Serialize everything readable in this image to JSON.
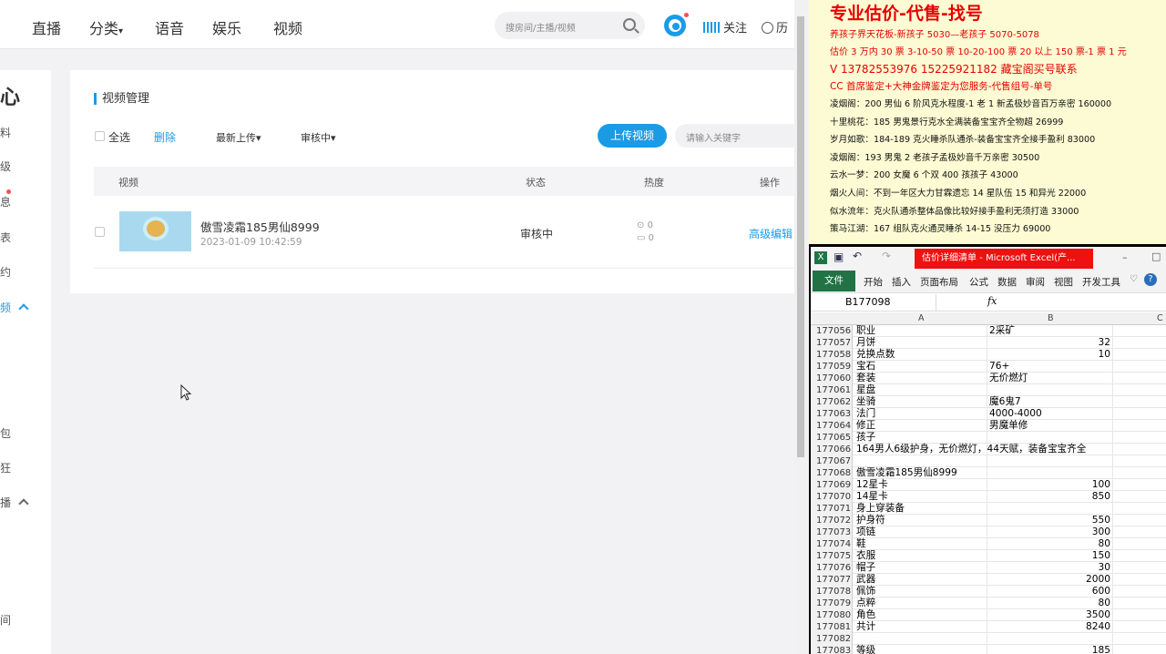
{
  "topnav": {
    "items": [
      "直播",
      "分类",
      "语音",
      "娱乐",
      "视频"
    ],
    "search_placeholder": "搜房间/主播/视频",
    "follow_label": "关注",
    "history_label": "历"
  },
  "sidebar": {
    "chars": [
      "心",
      "料",
      "级",
      "息",
      "表",
      "约",
      "频",
      "包",
      "狂",
      "播",
      "间"
    ]
  },
  "video_manage": {
    "title": "视频管理",
    "select_all": "全选",
    "delete": "删除",
    "sort": "最新上传",
    "filter": "审核中",
    "upload": "上传视频",
    "keyword_placeholder": "请输入关键字",
    "columns": [
      "视频",
      "状态",
      "热度",
      "操作"
    ],
    "row": {
      "title": "傲雪凌霜185男仙8999",
      "date": "2023-01-09 10:42:59",
      "status": "审核中",
      "plays": "0",
      "comments": "0",
      "action": "高级编辑"
    }
  },
  "notes": {
    "heading": "专业估价-代售-找号",
    "lines_red_small": [
      "养孩子界天花板-新孩子 5030—老孩子 5070-5078",
      "估价 3 万内 30 票  3-10-50 票  10-20-100 票 20 以上 150 票-1 票 1 元"
    ],
    "contact": "V 13782553976    15225921182   藏宝阁买号联系",
    "cc_line": "CC 首席鉴定+大神金牌鉴定为您服务-代售组号-单号",
    "lines": [
      "凌烟阁：200 男仙 6 阶风克水程度-1 老 1 新孟极妙音百万亲密 160000",
      "十里桃花：185 男鬼景行克水全满装备宝宝齐全物超 26999",
      "岁月如歌：184-189 克火睡杀队通杀-装备宝宝齐全接手盈利 83000",
      "凌烟阁：193 男鬼 2 老孩子孟极妙音千万亲密 30500",
      "云水一梦：200 女魔 6 个双 400 孩孩子 43000",
      "烟火人间：不到一年区大力甘霖遗忘 14 星队伍 15 和异光 22000",
      "似水流年：克火队通杀整体品像比较好接手盈利无须打造 33000",
      "策马江湖：167 组队克火通灵睡杀 14-15 没压力 69000"
    ]
  },
  "excel": {
    "title": "估价详细清单 - Microsoft Excel(产...",
    "tabs": [
      "文件",
      "开始",
      "插入",
      "页面布局",
      "公式",
      "数据",
      "审阅",
      "视图",
      "开发工具"
    ],
    "namebox": "B177098",
    "fx": "fx",
    "col_headers": [
      "A",
      "B",
      "C"
    ],
    "rows": [
      {
        "n": "177056",
        "a": "职业",
        "b": "2采矿",
        "num": false
      },
      {
        "n": "177057",
        "a": "月饼",
        "b": "32",
        "num": true
      },
      {
        "n": "177058",
        "a": "兑换点数",
        "b": "10",
        "num": true
      },
      {
        "n": "177059",
        "a": "宝石",
        "b": "76+",
        "num": false
      },
      {
        "n": "177060",
        "a": "套装",
        "b": "无价燃灯",
        "num": false
      },
      {
        "n": "177061",
        "a": "星盘",
        "b": "",
        "num": false
      },
      {
        "n": "177062",
        "a": "坐骑",
        "b": "魔6鬼7",
        "num": false
      },
      {
        "n": "177063",
        "a": "法门",
        "b": "4000-4000",
        "num": false
      },
      {
        "n": "177064",
        "a": "修正",
        "b": "男魔单修",
        "num": false
      },
      {
        "n": "177065",
        "a": "孩子",
        "b": "",
        "num": false
      },
      {
        "n": "177066",
        "a": "164男人6级护身，无价燃灯，44天赋，装备宝宝齐全",
        "b": "",
        "num": false
      },
      {
        "n": "177067",
        "a": "",
        "b": "",
        "num": false
      },
      {
        "n": "177068",
        "a": "傲雪凌霜185男仙8999",
        "b": "",
        "num": false
      },
      {
        "n": "177069",
        "a": "12星卡",
        "b": "100",
        "num": true
      },
      {
        "n": "177070",
        "a": "14星卡",
        "b": "850",
        "num": true
      },
      {
        "n": "177071",
        "a": "身上穿装备",
        "b": "",
        "num": false
      },
      {
        "n": "177072",
        "a": "护身符",
        "b": "550",
        "num": true
      },
      {
        "n": "177073",
        "a": "项链",
        "b": "300",
        "num": true
      },
      {
        "n": "177074",
        "a": "鞋",
        "b": "80",
        "num": true
      },
      {
        "n": "177075",
        "a": "衣服",
        "b": "150",
        "num": true
      },
      {
        "n": "177076",
        "a": "帽子",
        "b": "30",
        "num": true
      },
      {
        "n": "177077",
        "a": "武器",
        "b": "2000",
        "num": true
      },
      {
        "n": "177078",
        "a": "佩饰",
        "b": "600",
        "num": true
      },
      {
        "n": "177079",
        "a": "点粹",
        "b": "80",
        "num": true
      },
      {
        "n": "177080",
        "a": "角色",
        "b": "3500",
        "num": true
      },
      {
        "n": "177081",
        "a": "共计",
        "b": "8240",
        "num": true
      },
      {
        "n": "177082",
        "a": "",
        "b": "",
        "num": false
      },
      {
        "n": "177083",
        "a": "等级",
        "b": "185",
        "num": true
      }
    ]
  }
}
